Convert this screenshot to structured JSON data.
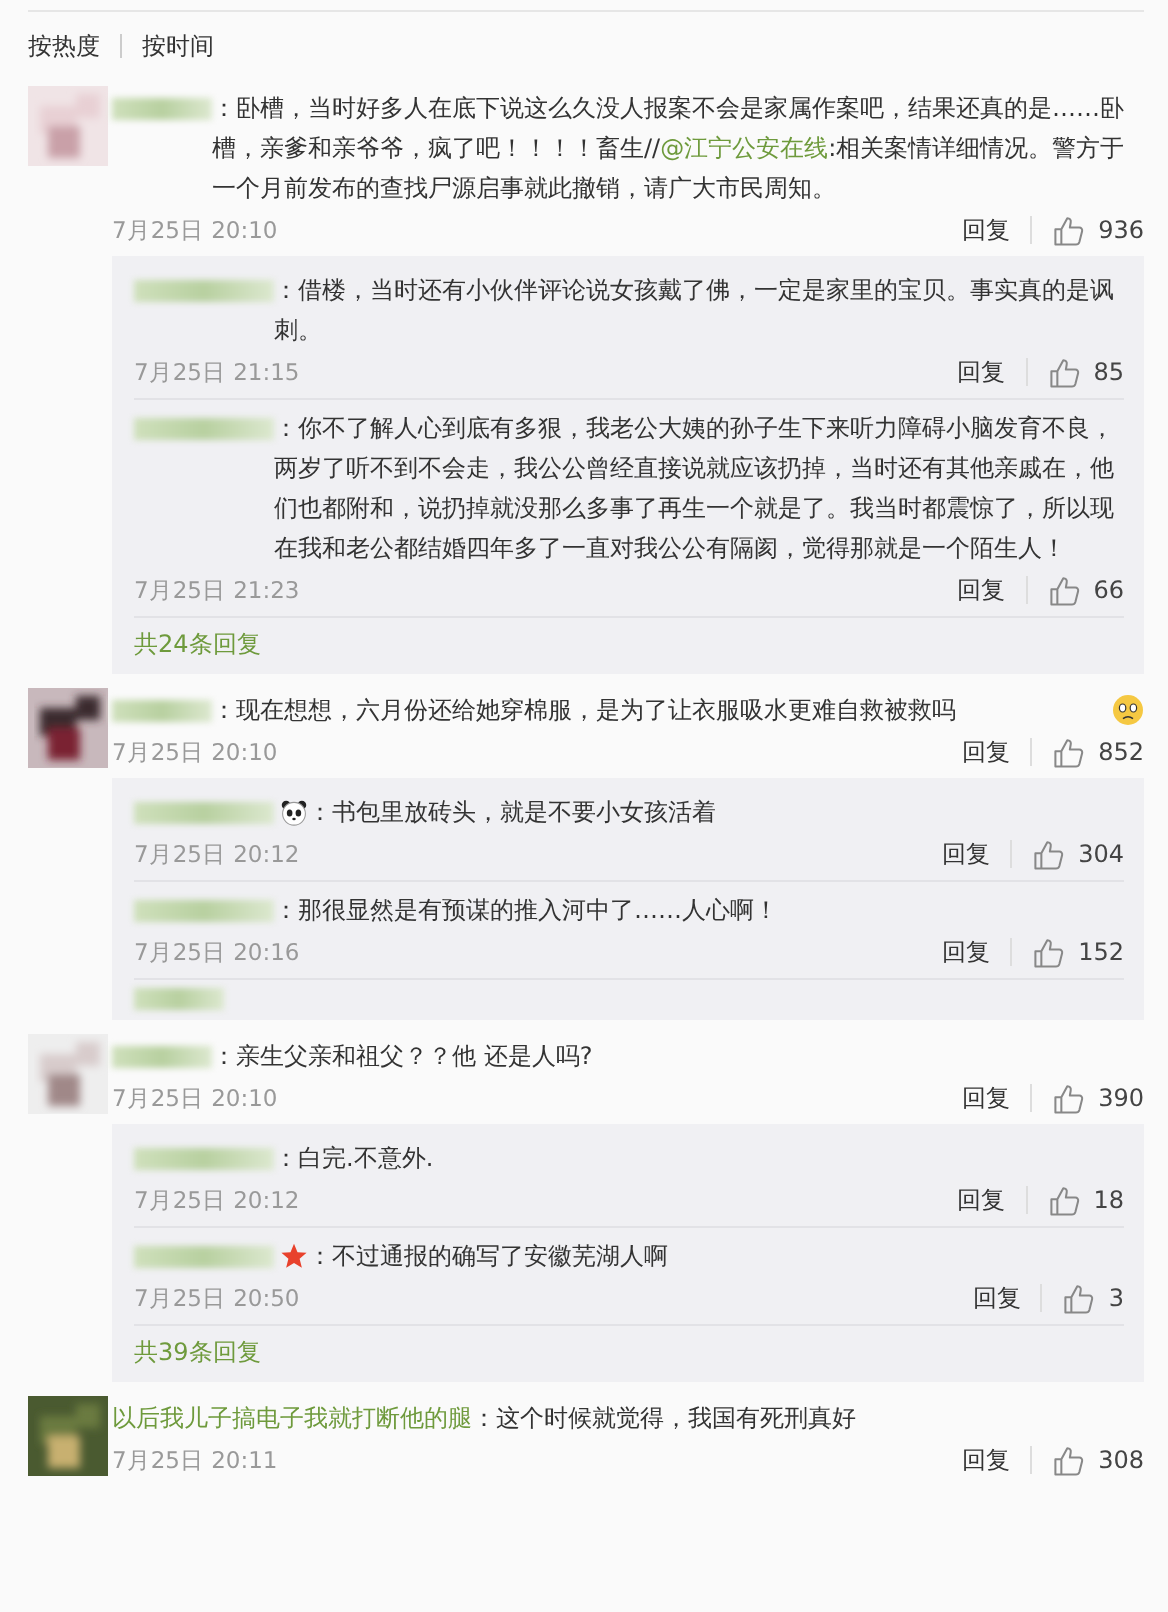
{
  "sort_tabs": [
    {
      "label": "按热度"
    },
    {
      "label": "按时间"
    }
  ],
  "comments": [
    {
      "kind": "plain",
      "text": "：卧槽，当时好多人在底下说这么久没人报案不会是家属作案吧，结果还真的是……卧槽，亲爹和亲爷爷，疯了吧！！！！畜生//",
      "mention": "@江宁公安在线",
      "text_after": ":相关案情详细情况。警方于一个月前发布的查找尸源启事就此撤销，请广大市民周知。",
      "date": "7月25日 20:10",
      "reply": "回复",
      "likes": "936",
      "replies": [
        {
          "kind": "plain",
          "text": "：借楼，当时还有小伙伴评论说女孩戴了佛，一定是家里的宝贝。事实真的是讽刺。",
          "date": "7月25日 21:15",
          "reply": "回复",
          "likes": "85"
        },
        {
          "kind": "plain",
          "text": "：你不了解人心到底有多狠，我老公大姨的孙子生下来听力障碍小脑发育不良，两岁了听不到不会走，我公公曾经直接说就应该扔掉，当时还有其他亲戚在，他们也都附和，说扔掉就没那么多事了再生一个就是了。我当时都震惊了，所以现在我和老公都结婚四年多了一直对我公公有隔阂，觉得那就是一个陌生人！",
          "date": "7月25日 21:23",
          "reply": "回复",
          "likes": "66"
        }
      ],
      "more_replies": "共24条回复"
    },
    {
      "kind": "emoji_end",
      "text": "：现在想想，六月份还给她穿棉服，是为了让衣服吸水更难自救被救吗",
      "date": "7月25日 20:10",
      "reply": "回复",
      "likes": "852",
      "replies": [
        {
          "kind": "panda_badge",
          "text": "：书包里放砖头，就是不要小女孩活着",
          "date": "7月25日 20:12",
          "reply": "回复",
          "likes": "304"
        },
        {
          "kind": "plain",
          "text": "：那很显然是有预谋的推入河中了……人心啊！",
          "date": "7月25日 20:16",
          "reply": "回复",
          "likes": "152"
        },
        {
          "kind": "cut"
        }
      ]
    },
    {
      "kind": "plain",
      "text": "：亲生父亲和祖父？？他 还是人吗?",
      "date": "7月25日 20:10",
      "reply": "回复",
      "likes": "390",
      "replies": [
        {
          "kind": "plain",
          "text": "：白完.不意外.",
          "date": "7月25日 20:12",
          "reply": "回复",
          "likes": "18"
        },
        {
          "kind": "star_badge",
          "text": "：不过通报的确写了安徽芜湖人啊",
          "date": "7月25日 20:50",
          "reply": "回复",
          "likes": "3"
        }
      ],
      "more_replies": "共39条回复"
    },
    {
      "kind": "plain",
      "name": "以后我儿子搞电子我就打断他的腿",
      "text": "：这个时候就觉得，我国有死刑真好",
      "date": "7月25日 20:11",
      "reply": "回复",
      "likes": "308"
    }
  ]
}
